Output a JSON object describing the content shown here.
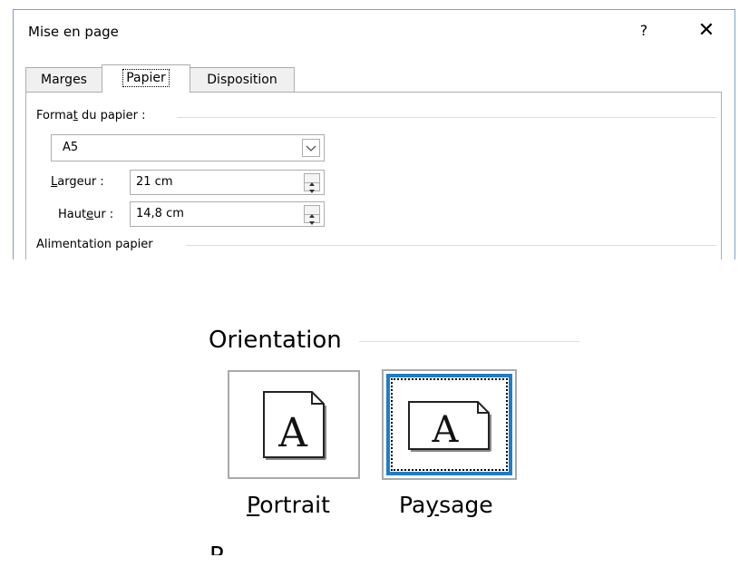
{
  "dialog": {
    "title": "Mise en page",
    "help_glyph": "?",
    "close_glyph": "✕",
    "tabs": [
      {
        "label": "Marges"
      },
      {
        "label": "Papier"
      },
      {
        "label": "Disposition"
      }
    ],
    "active_tab": "Papier",
    "paper_format": {
      "group_label_pre": "Forma",
      "group_label_ul": "t",
      "group_label_post": " du papier :",
      "selected": "A5"
    },
    "width": {
      "label_ul": "L",
      "label_post": "argeur :",
      "value": "21 cm"
    },
    "height": {
      "label_pre": "Haut",
      "label_ul": "e",
      "label_post": "ur :",
      "value": "14,8 cm"
    },
    "paper_source": {
      "group_label": "Alimentation papier"
    }
  },
  "orientation": {
    "group_label": "Orientation",
    "portrait": {
      "label_ul": "P",
      "label_post": "ortrait",
      "glyph": "A"
    },
    "landscape": {
      "label_pre": "Pa",
      "label_ul": "y",
      "label_post": "sage",
      "glyph": "A"
    },
    "selected": "Paysage",
    "cut_text": "P"
  },
  "colors": {
    "accent": "#1f7dc8",
    "border": "#adadad",
    "window_frame": "#7a9fcf"
  }
}
